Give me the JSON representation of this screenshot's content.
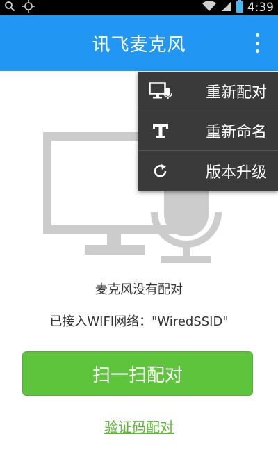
{
  "status_bar": {
    "time": "4:39",
    "icons": [
      "search-icon",
      "gps-icon",
      "wifi-icon",
      "signal-icon",
      "battery-icon"
    ]
  },
  "app_bar": {
    "title": "讯飞麦克风",
    "overflow_icon": "more-vertical-icon",
    "color": "#2196f3"
  },
  "overflow_menu": {
    "items": [
      {
        "label": "重新配对",
        "icon": "monitor-mic-icon"
      },
      {
        "label": "重新命名",
        "icon": "text-icon"
      },
      {
        "label": "版本升级",
        "icon": "refresh-icon"
      }
    ]
  },
  "main": {
    "illustration": "monitor-microphone-illustration",
    "warning_icon": "warning-icon",
    "status": "麦克风没有配对",
    "wifi_status": "已接入WIFI网络：\"WiredSSID\"",
    "scan_button": "扫一扫配对",
    "code_link": "验证码配对"
  },
  "colors": {
    "accent": "#2196f3",
    "button": "#5ec43c",
    "link": "#5cb833",
    "warning": "#d32f2f"
  }
}
